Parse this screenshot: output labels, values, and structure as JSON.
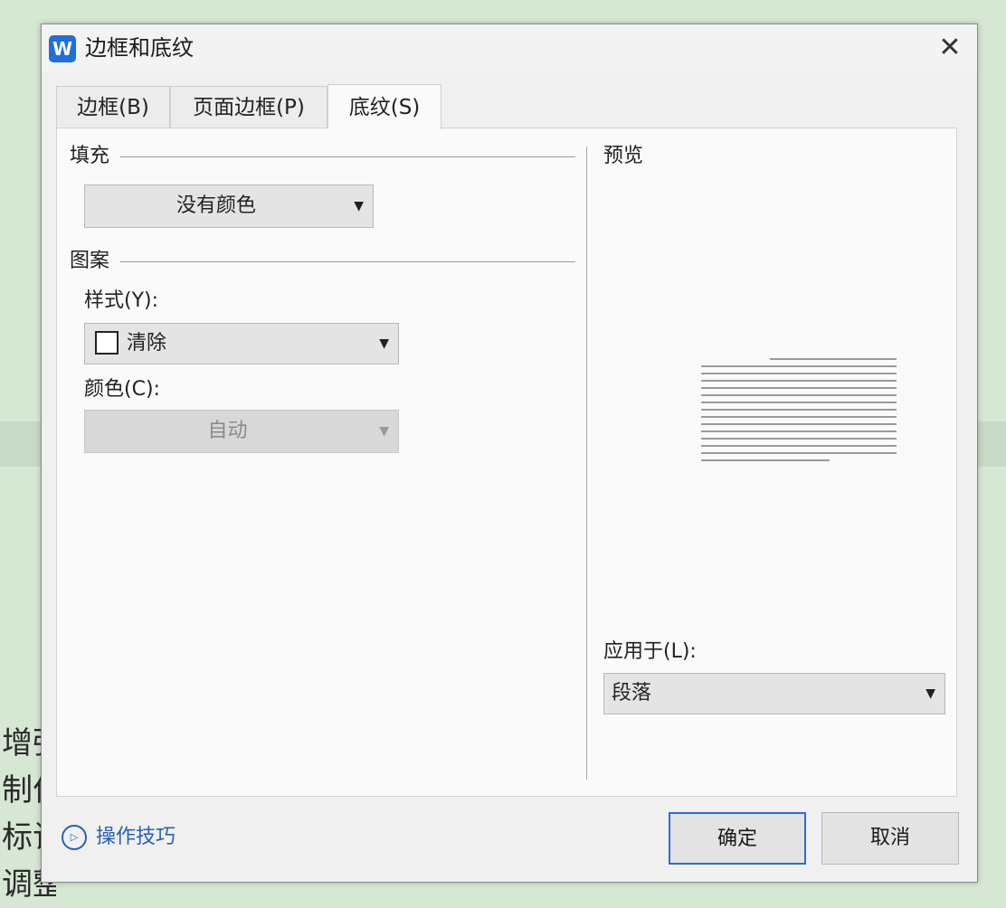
{
  "background_document": {
    "text_lines": [
      "增强",
      "制作",
      "标记",
      "调整版面"
    ]
  },
  "dialog": {
    "title": "边框和底纹",
    "app_icon": "W",
    "close_symbol": "✕",
    "tabs": [
      {
        "label": "边框(B)",
        "active": false
      },
      {
        "label": "页面边框(P)",
        "active": false
      },
      {
        "label": "底纹(S)",
        "active": true
      }
    ],
    "fill": {
      "section_label": "填充",
      "dropdown_value": "没有颜色"
    },
    "pattern": {
      "section_label": "图案",
      "style_label": "样式(Y):",
      "style_value": "清除",
      "color_label": "颜色(C):",
      "color_value": "自动"
    },
    "preview": {
      "label": "预览"
    },
    "apply_to": {
      "label": "应用于(L):",
      "value": "段落"
    },
    "hint_link": "操作技巧",
    "buttons": {
      "ok": "确定",
      "cancel": "取消"
    },
    "colors": {
      "accent": "#2a6fd0",
      "link": "#2a5fb5",
      "app_icon_bg": "#1f6fe0",
      "background_green": "#d6e7d3"
    },
    "icons": {
      "app": "wps-writer-icon",
      "close": "close-icon",
      "dropdown_arrow": "caret-down-icon",
      "hint": "play-circle-icon"
    }
  }
}
